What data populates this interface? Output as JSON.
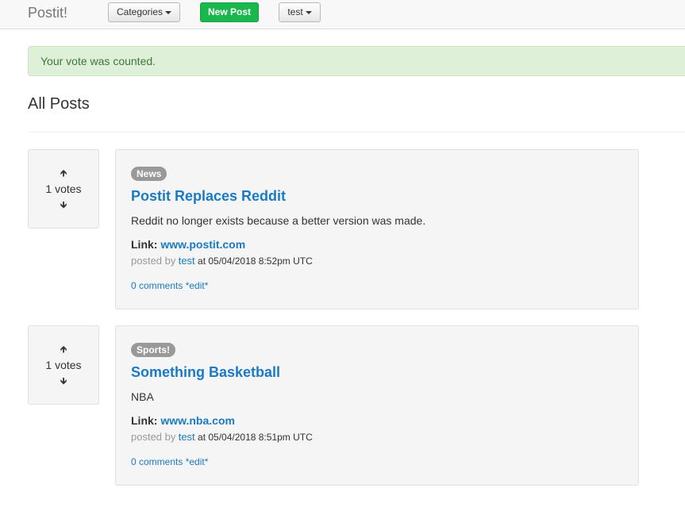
{
  "navbar": {
    "brand": "Postit!",
    "categories_label": "Categories",
    "new_post_label": "New Post",
    "user_label": "test"
  },
  "alert": {
    "message": "Your vote was counted."
  },
  "page": {
    "heading": "All Posts"
  },
  "posts": [
    {
      "votes": "1 votes",
      "category": "News",
      "title": "Postit Replaces Reddit",
      "description": "Reddit no longer exists because a better version was made.",
      "link_label": "Link:",
      "link_url": "www.postit.com",
      "posted_by_label": "posted by",
      "author": "test",
      "timestamp": "at 05/04/2018 8:52pm UTC",
      "comments": "0 comments",
      "edit": "*edit*"
    },
    {
      "votes": "1 votes",
      "category": "Sports!",
      "title": "Something Basketball",
      "description": "NBA",
      "link_label": "Link:",
      "link_url": "www.nba.com",
      "posted_by_label": "posted by",
      "author": "test",
      "timestamp": "at 05/04/2018 8:51pm UTC",
      "comments": "0 comments",
      "edit": "*edit*"
    }
  ],
  "icons": {
    "upvote": "arrow-up-icon",
    "downvote": "arrow-down-icon",
    "dropdown": "caret-down-icon"
  },
  "colors": {
    "link": "#1a7ac4",
    "success": "#19b84d",
    "alert_bg": "#dff0d8",
    "alert_text": "#3c763d",
    "badge": "#999999"
  }
}
